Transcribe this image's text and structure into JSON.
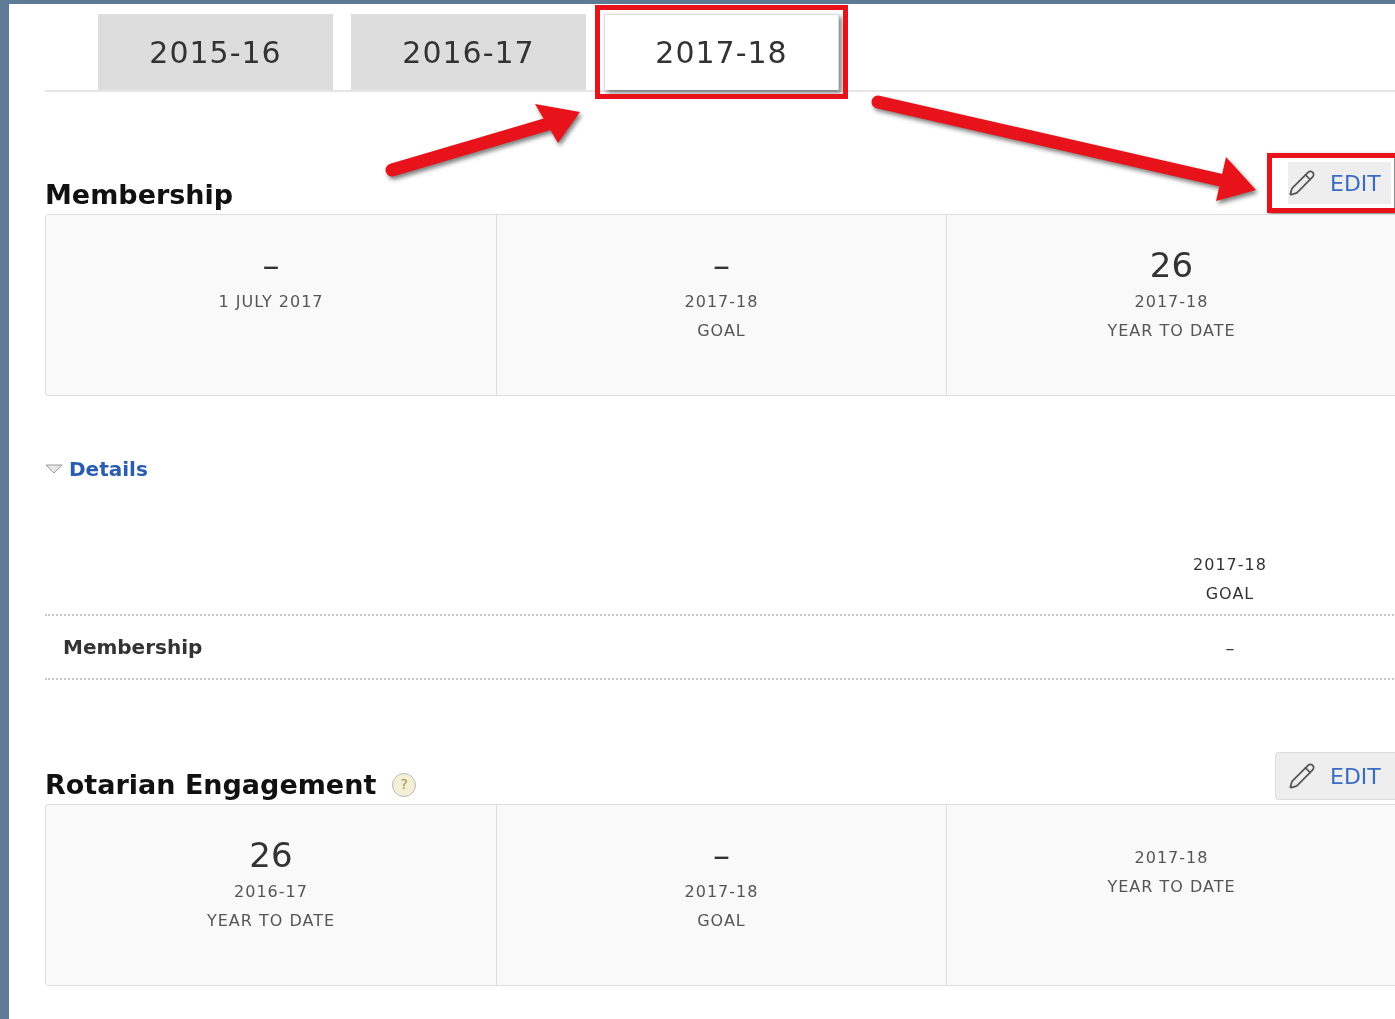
{
  "tabs": [
    {
      "label": "2015-16",
      "selected": false,
      "highlighted": false
    },
    {
      "label": "2016-17",
      "selected": false,
      "highlighted": false
    },
    {
      "label": "2017-18",
      "selected": true,
      "highlighted": true
    }
  ],
  "sections": [
    {
      "title": "Membership",
      "edit": {
        "label": "EDIT",
        "highlighted": true
      },
      "cards": [
        {
          "value": "–",
          "lines": [
            "1 JULY 2017"
          ]
        },
        {
          "value": "–",
          "lines": [
            "2017-18",
            "GOAL"
          ]
        },
        {
          "value": "26",
          "lines": [
            "2017-18",
            "YEAR TO DATE"
          ]
        }
      ],
      "details": {
        "label": "Details",
        "expanded": true,
        "columns": [
          {
            "lines": [
              "2017-18",
              "GOAL"
            ]
          }
        ],
        "rows": [
          {
            "label": "Membership",
            "cells": [
              "–"
            ]
          }
        ]
      }
    },
    {
      "title": "Rotarian Engagement",
      "help": "?",
      "edit": {
        "label": "EDIT",
        "highlighted": false
      },
      "cards": [
        {
          "value": "26",
          "lines": [
            "2016-17",
            "YEAR TO DATE"
          ]
        },
        {
          "value": "–",
          "lines": [
            "2017-18",
            "GOAL"
          ]
        },
        {
          "lines": [
            "2017-18",
            "YEAR TO DATE"
          ]
        }
      ]
    }
  ]
}
